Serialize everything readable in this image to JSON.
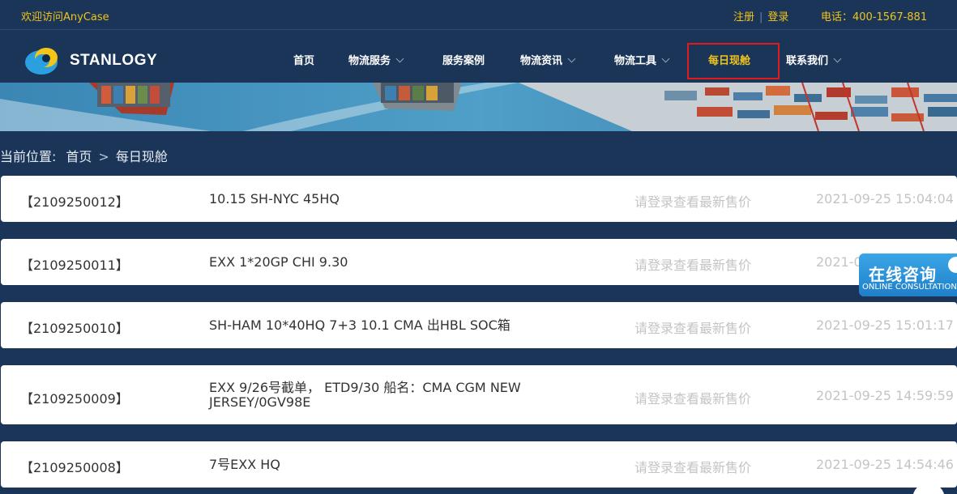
{
  "topbar": {
    "welcome": "欢迎访问AnyCase",
    "register": "注册",
    "login": "登录",
    "phone": "电话：400-1567-881"
  },
  "brand": {
    "name": "STANLOGY"
  },
  "nav": {
    "items": [
      {
        "label": "首页"
      },
      {
        "label": "物流服务"
      },
      {
        "label": "服务案例"
      },
      {
        "label": "物流资讯"
      },
      {
        "label": "物流工具"
      },
      {
        "label": "每日现舱"
      },
      {
        "label": "联系我们"
      }
    ]
  },
  "breadcrumb": {
    "prefix": "当前位置:",
    "home": "首页",
    "separator": ">",
    "current": "每日现舱"
  },
  "list": [
    {
      "id": "【2109250012】",
      "title": "10.15 SH-NYC 45HQ",
      "price": "请登录查看最新售价",
      "time": "2021-09-25 15:04:04"
    },
    {
      "id": "【2109250011】",
      "title": "EXX 1*20GP CHI 9.30",
      "price": "请登录查看最新售价",
      "time": "2021-09-25 15:03:"
    },
    {
      "id": "【2109250010】",
      "title": "SH-HAM 10*40HQ 7+3 10.1 CMA 出HBL SOC箱",
      "price": "请登录查看最新售价",
      "time": "2021-09-25 15:01:17"
    },
    {
      "id": "【2109250009】",
      "title": "EXX 9/26号截单， ETD9/30 船名：CMA CGM NEW JERSEY/0GV98E",
      "price": "请登录查看最新售价",
      "time": "2021-09-25 14:59:59"
    },
    {
      "id": "【2109250008】",
      "title": "7号EXX HQ",
      "price": "请登录查看最新售价",
      "time": "2021-09-25 14:54:46"
    }
  ],
  "consult": {
    "label_cn": "在线咨询",
    "label_en": "ONLINE CONSULTATION"
  },
  "colors": {
    "background": "#1b3558",
    "accent": "#f0c419",
    "highlight_box": "#e01b1b",
    "muted_text": "#c4c4c4"
  }
}
